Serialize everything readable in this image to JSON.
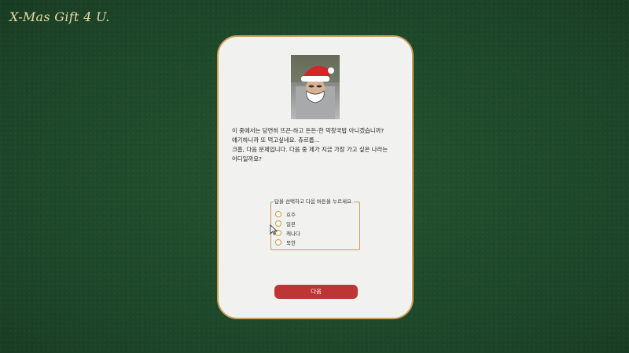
{
  "app": {
    "title": "X-Mas Gift 4 U."
  },
  "question": {
    "lines": [
      "이 중에서는 당연히 뜨끈-하고 든든-한 막창국밥 아니겠습니까?",
      "얘기하니까 또 먹고싶네요. 츄르릅...",
      "크흠, 다음 문제입니다. 다음 중 제가 지금 가장 가고 싶은 나라는",
      "어디일까요?"
    ]
  },
  "answers": {
    "legend": "답을 선택하고 다음 버튼을 누르세요.",
    "options": [
      {
        "label": "호주"
      },
      {
        "label": "일본"
      },
      {
        "label": "캐나다"
      },
      {
        "label": "북한"
      }
    ]
  },
  "actions": {
    "next_label": "다음"
  },
  "colors": {
    "background": "#1f4a2c",
    "card_border": "#caa25a",
    "button": "#bd3535",
    "title": "#e9d9a6"
  },
  "icons": {
    "photo": "santa-hat-photo",
    "cursor": "pointer-cursor"
  }
}
